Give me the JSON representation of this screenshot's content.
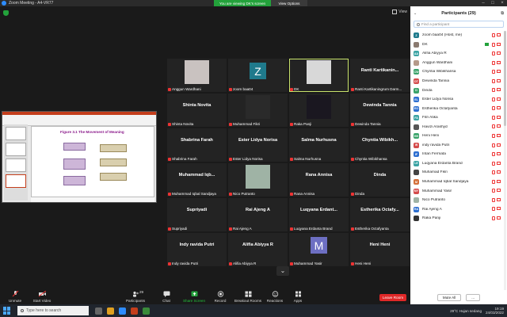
{
  "window": {
    "title": "Zoom Meeting - A4-VR77",
    "banner_viewing": "You are viewing DK's screen",
    "view_options": "View Options",
    "view_button": "View"
  },
  "slide": {
    "title": "Figure 3.1 The Movement of Meaning"
  },
  "gallery": [
    {
      "name": "Anggun Wardhani",
      "big": "",
      "kind": "photo",
      "photo": "#c9c2c0"
    },
    {
      "name": "zoom baa04",
      "big": "",
      "kind": "letter",
      "letter": "Z",
      "color": "#1f7a8c"
    },
    {
      "name": "DK",
      "big": "",
      "kind": "photo",
      "photo": "#d8d8d8",
      "active": true
    },
    {
      "name": "Ranti Kartikaningrum Darm...",
      "big": "Ranti Kartikanin...",
      "kind": "text"
    },
    {
      "name": "Shinta Novita",
      "big": "Shinta Novita",
      "kind": "text"
    },
    {
      "name": "Muhammad Fikri",
      "big": "",
      "kind": "photo",
      "photo": "#2a2a2a"
    },
    {
      "name": "Raka Panji",
      "big": "",
      "kind": "photo",
      "photo": "#1a1720"
    },
    {
      "name": "Dewinda Tannia",
      "big": "Dewinda Tannia",
      "kind": "text"
    },
    {
      "name": "Shabrina Farah",
      "big": "Shabrina Farah",
      "kind": "text"
    },
    {
      "name": "Ester Lidya Norisa",
      "big": "Ester Lidya Norisa",
      "kind": "text"
    },
    {
      "name": "Salma Nurhusna",
      "big": "Salma Nurhusna",
      "kind": "text"
    },
    {
      "name": "Chyntia Wibikhansa",
      "big": "Chyntia Wibikh...",
      "kind": "text"
    },
    {
      "name": "Muhammad Iqbal Sandjaya",
      "big": "Muhammad Iqb...",
      "kind": "text"
    },
    {
      "name": "Nico Putranto",
      "big": "",
      "kind": "photo",
      "photo": "#9fb3a5"
    },
    {
      "name": "Rana Annisa",
      "big": "Rana Annisa",
      "kind": "text"
    },
    {
      "name": "Dinda",
      "big": "Dinda",
      "kind": "text"
    },
    {
      "name": "Supriyadi",
      "big": "Supriyadi",
      "kind": "text"
    },
    {
      "name": "Rai Ajeng A",
      "big": "Rai Ajeng A",
      "kind": "text"
    },
    {
      "name": "Luqyana Erdanta Brand",
      "big": "Luqyana Erdant...",
      "kind": "text"
    },
    {
      "name": "Estherika Octafyanta",
      "big": "Estherika Octafy...",
      "kind": "text"
    },
    {
      "name": "Indy ravida Putri",
      "big": "Indy ravida Putri",
      "kind": "text"
    },
    {
      "name": "Alifia Abiyya R",
      "big": "Alifia Abiyya R",
      "kind": "text"
    },
    {
      "name": "Muhammad Yasir",
      "big": "",
      "kind": "letter",
      "letter": "M",
      "color": "#6d6fc2"
    },
    {
      "name": "Heni Heni",
      "big": "Heni Heni",
      "kind": "text"
    }
  ],
  "participants": {
    "title": "Participants (29)",
    "search_placeholder": "Find a participant",
    "mute_all": "Mute All",
    "more": "...",
    "list": [
      {
        "name": "zoom baa04 (Host, me)",
        "initials": "Z",
        "color": "#1f7a8c"
      },
      {
        "name": "DK",
        "initials": "",
        "color": "#8a7a70",
        "sharing": true
      },
      {
        "name": "Alifia Abiyya R",
        "initials": "AA",
        "color": "#3aa3a3"
      },
      {
        "name": "Anggun Wardhani",
        "initials": "",
        "color": "#b59a8a"
      },
      {
        "name": "Chyntia Wibikhansa",
        "initials": "CW",
        "color": "#3aa36a"
      },
      {
        "name": "Dewinda Tannia",
        "initials": "DT",
        "color": "#d44b4b"
      },
      {
        "name": "Dinda",
        "initials": "D",
        "color": "#3aa36a"
      },
      {
        "name": "Ester Lidya Norisa",
        "initials": "EL",
        "color": "#2d6fd0"
      },
      {
        "name": "Estherika Octafyanta",
        "initials": "EO",
        "color": "#2d6fd0"
      },
      {
        "name": "Fitri Atika",
        "initials": "FA",
        "color": "#3aa3a3"
      },
      {
        "name": "Havizi Arashyd",
        "initials": "",
        "color": "#555555"
      },
      {
        "name": "Heni Heni",
        "initials": "HH",
        "color": "#3aa36a"
      },
      {
        "name": "indy ravida Putri",
        "initials": "IR",
        "color": "#d44b4b"
      },
      {
        "name": "Intan Fermata",
        "initials": "IF",
        "color": "#2d6fd0"
      },
      {
        "name": "Luqyana Erdanta Brand",
        "initials": "LE",
        "color": "#3aa3a3"
      },
      {
        "name": "Muhamad Fikri",
        "initials": "",
        "color": "#444444"
      },
      {
        "name": "Muhammad Iqbal Sandjaya",
        "initials": "M",
        "color": "#d4703a"
      },
      {
        "name": "Muhammad Yasir",
        "initials": "MY",
        "color": "#d44b4b"
      },
      {
        "name": "Nico Putranto",
        "initials": "",
        "color": "#9fb3a5"
      },
      {
        "name": "Rai Ajeng A",
        "initials": "RA",
        "color": "#2d6fd0"
      },
      {
        "name": "Raka Panji",
        "initials": "",
        "color": "#333333"
      }
    ]
  },
  "toolbar": {
    "unmute": "Unmute",
    "start_video": "Start Video",
    "participants": "Participants",
    "participants_count": "29",
    "chat": "Chat",
    "share_screen": "Share Screen",
    "record": "Record",
    "breakout": "Breakout Rooms",
    "reactions": "Reactions",
    "apps": "Apps",
    "leave": "Leave Room"
  },
  "taskbar": {
    "search_placeholder": "Type here to search",
    "weather": "29°C Hujan sedang",
    "time": "19:19",
    "date": "24/03/2022"
  }
}
